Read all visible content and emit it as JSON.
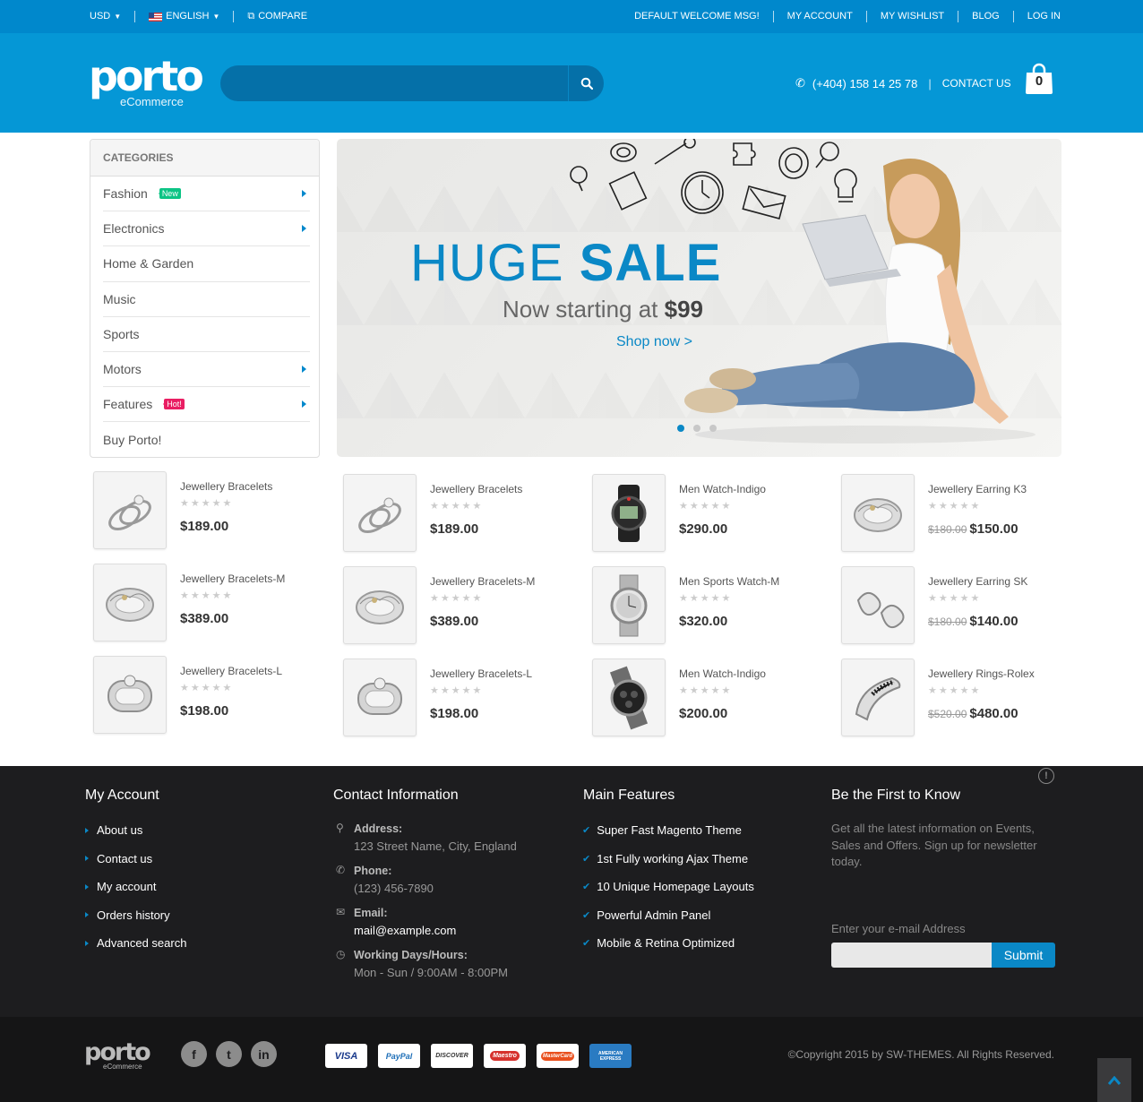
{
  "topbar": {
    "currency": "USD",
    "language": "ENGLISH",
    "compare": "COMPARE",
    "links": [
      "DEFAULT WELCOME MSG!",
      "MY ACCOUNT",
      "MY WISHLIST",
      "BLOG",
      "LOG IN"
    ]
  },
  "header": {
    "logo_word": "porto",
    "logo_sub": "eCommerce",
    "search_placeholder": "",
    "phone": "(+404) 158 14 25 78",
    "contact": "CONTACT US",
    "cart_count": "0"
  },
  "categories": {
    "title": "CATEGORIES",
    "items": [
      {
        "label": "Fashion",
        "badge": "New",
        "arrow": true
      },
      {
        "label": "Electronics",
        "badge": "",
        "arrow": true
      },
      {
        "label": "Home & Garden",
        "badge": "",
        "arrow": false
      },
      {
        "label": "Music",
        "badge": "",
        "arrow": false
      },
      {
        "label": "Sports",
        "badge": "",
        "arrow": false
      },
      {
        "label": "Motors",
        "badge": "",
        "arrow": true
      },
      {
        "label": "Features",
        "badge": "Hot!",
        "arrow": true
      },
      {
        "label": "Buy Porto!",
        "badge": "",
        "arrow": false
      }
    ]
  },
  "banner": {
    "huge": "HUGE",
    "sale": "SALE",
    "starting": "Now starting at",
    "price": "$99",
    "shop": "Shop now >",
    "slides": 3,
    "active_slide": 1
  },
  "products": [
    {
      "name": "Jewellery Bracelets",
      "price": "$189.00",
      "old": "",
      "icon": "ring-pair"
    },
    {
      "name": "Jewellery Bracelets-M",
      "price": "$389.00",
      "old": "",
      "icon": "ornate-ring"
    },
    {
      "name": "Jewellery Bracelets-L",
      "price": "$198.00",
      "old": "",
      "icon": "band-ring"
    },
    {
      "name": "Jewellery Bracelets",
      "price": "$189.00",
      "old": "",
      "icon": "ring-pair"
    },
    {
      "name": "Jewellery Bracelets-M",
      "price": "$389.00",
      "old": "",
      "icon": "ornate-ring"
    },
    {
      "name": "Jewellery Bracelets-L",
      "price": "$198.00",
      "old": "",
      "icon": "band-ring"
    },
    {
      "name": "Men Watch-Indigo",
      "price": "$290.00",
      "old": "",
      "icon": "sport-watch"
    },
    {
      "name": "Men Sports Watch-M",
      "price": "$320.00",
      "old": "",
      "icon": "silver-watch"
    },
    {
      "name": "Men Watch-Indigo",
      "price": "$200.00",
      "old": "",
      "icon": "chrono-watch"
    },
    {
      "name": "Jewellery Earring K3",
      "price": "$150.00",
      "old": "$180.00",
      "icon": "ornate-ring"
    },
    {
      "name": "Jewellery Earring SK",
      "price": "$140.00",
      "old": "$180.00",
      "icon": "earring"
    },
    {
      "name": "Jewellery Rings-Rolex",
      "price": "$480.00",
      "old": "$520.00",
      "icon": "cuff"
    }
  ],
  "footer": {
    "account": {
      "title": "My Account",
      "links": [
        "About us",
        "Contact us",
        "My account",
        "Orders history",
        "Advanced search"
      ]
    },
    "contact": {
      "title": "Contact Information",
      "address_label": "Address:",
      "address": "123 Street Name, City, England",
      "phone_label": "Phone:",
      "phone": "(123) 456-7890",
      "email_label": "Email:",
      "email": "mail@example.com",
      "hours_label": "Working Days/Hours:",
      "hours": "Mon - Sun / 9:00AM - 8:00PM"
    },
    "features": {
      "title": "Main Features",
      "items": [
        "Super Fast Magento Theme",
        "1st Fully working Ajax Theme",
        "10 Unique Homepage Layouts",
        "Powerful Admin Panel",
        "Mobile & Retina Optimized"
      ]
    },
    "newsletter": {
      "title": "Be the First to Know",
      "text": "Get all the latest information on Events, Sales and Offers. Sign up for newsletter today.",
      "label": "Enter your e-mail Address",
      "button": "Submit"
    }
  },
  "bottom": {
    "logo_word": "porto",
    "logo_sub": "eCommerce",
    "social": [
      "f",
      "t",
      "in"
    ],
    "cards": [
      "VISA",
      "PayPal",
      "DISCOVER",
      "Maestro",
      "MasterCard",
      "AMERICAN EXPRESS"
    ],
    "copyright": "©Copyright 2015 by SW-THEMES. All Rights Reserved."
  },
  "colors": {
    "primary": "#0088cc",
    "header": "#0597d6",
    "footer": "#1d1d1f"
  }
}
